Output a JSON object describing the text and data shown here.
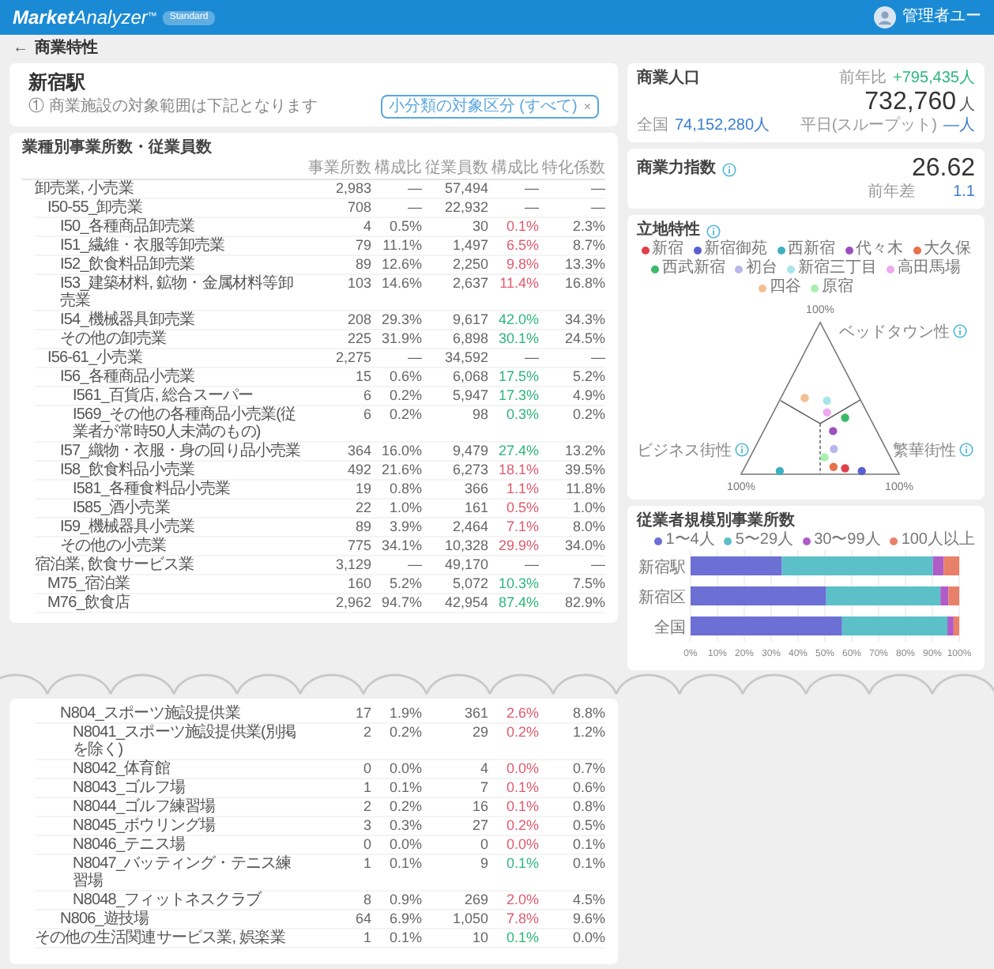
{
  "header": {
    "logo_bold": "Market",
    "logo_light": "Analyzer",
    "logo_mark": "™",
    "badge": "Standard",
    "user": "管理者ユー"
  },
  "breadcrumb": {
    "back": "←",
    "title": "商業特性"
  },
  "station": {
    "name": "新宿駅",
    "note": "① 商業施設の対象範囲は下記となります",
    "select": "小分類の対象区分 (すべて)",
    "select_clear": "×"
  },
  "industry_table": {
    "title": "業種別事業所数・従業員数",
    "columns": [
      "事業所数",
      "構成比",
      "従業員数",
      "構成比",
      "特化係数"
    ],
    "rows": [
      {
        "label": "卸売業, 小売業",
        "cells": [
          "2,983",
          "—",
          "57,494",
          "—",
          "—"
        ],
        "children": [
          {
            "label": "I50-55_卸売業",
            "cells": [
              "708",
              "—",
              "22,932",
              "—",
              "—"
            ],
            "children": [
              {
                "label": "I50_各種商品卸売業",
                "cells": [
                  "4",
                  "0.5%",
                  "30",
                  "0.1%",
                  "2.3%"
                ],
                "color": "#e05a6e"
              },
              {
                "label": "I51_繊維・衣服等卸売業",
                "cells": [
                  "79",
                  "11.1%",
                  "1,497",
                  "6.5%",
                  "8.7%"
                ],
                "color": "#e05a6e"
              },
              {
                "label": "I52_飲食料品卸売業",
                "cells": [
                  "89",
                  "12.6%",
                  "2,250",
                  "9.8%",
                  "13.3%"
                ],
                "color": "#e05a6e"
              },
              {
                "label": "I53_建築材料, 鉱物・金属材料等卸売業",
                "cells": [
                  "103",
                  "14.6%",
                  "2,637",
                  "11.4%",
                  "16.8%"
                ],
                "color": "#e05a6e"
              },
              {
                "label": "I54_機械器具卸売業",
                "cells": [
                  "208",
                  "29.3%",
                  "9,617",
                  "42.0%",
                  "34.3%"
                ],
                "color": "#2db67c"
              },
              {
                "label": "その他の卸売業",
                "cells": [
                  "225",
                  "31.9%",
                  "6,898",
                  "30.1%",
                  "24.5%"
                ],
                "color": "#2db67c"
              }
            ]
          },
          {
            "label": "I56-61_小売業",
            "cells": [
              "2,275",
              "—",
              "34,592",
              "—",
              "—"
            ],
            "children": [
              {
                "label": "I56_各種商品小売業",
                "cells": [
                  "15",
                  "0.6%",
                  "6,068",
                  "17.5%",
                  "5.2%"
                ],
                "color": "#2db67c",
                "children": [
                  {
                    "label": "I561_百貨店, 総合スーパー",
                    "cells": [
                      "6",
                      "0.2%",
                      "5,947",
                      "17.3%",
                      "4.9%"
                    ],
                    "color": "#2db67c"
                  },
                  {
                    "label": "I569_その他の各種商品小売業(従業者が常時50人未満のもの)",
                    "cells": [
                      "6",
                      "0.2%",
                      "98",
                      "0.3%",
                      "0.2%"
                    ],
                    "color": "#2db67c"
                  }
                ]
              },
              {
                "label": "I57_織物・衣服・身の回り品小売業",
                "cells": [
                  "364",
                  "16.0%",
                  "9,479",
                  "27.4%",
                  "13.2%"
                ],
                "color": "#2db67c"
              },
              {
                "label": "I58_飲食料品小売業",
                "cells": [
                  "492",
                  "21.6%",
                  "6,273",
                  "18.1%",
                  "39.5%"
                ],
                "color": "#e05a6e",
                "children": [
                  {
                    "label": "I581_各種食料品小売業",
                    "cells": [
                      "19",
                      "0.8%",
                      "366",
                      "1.1%",
                      "11.8%"
                    ],
                    "color": "#e05a6e"
                  },
                  {
                    "label": "I585_酒小売業",
                    "cells": [
                      "22",
                      "1.0%",
                      "161",
                      "0.5%",
                      "1.0%"
                    ],
                    "color": "#e05a6e"
                  }
                ]
              },
              {
                "label": "I59_機械器具小売業",
                "cells": [
                  "89",
                  "3.9%",
                  "2,464",
                  "7.1%",
                  "8.0%"
                ],
                "color": "#e05a6e"
              },
              {
                "label": "その他の小売業",
                "cells": [
                  "775",
                  "34.1%",
                  "10,328",
                  "29.9%",
                  "34.0%"
                ],
                "color": "#e05a6e"
              }
            ]
          }
        ]
      },
      {
        "label": "宿泊業, 飲食サービス業",
        "cells": [
          "3,129",
          "—",
          "49,170",
          "—",
          "—"
        ],
        "children": [
          {
            "label": "M75_宿泊業",
            "cells": [
              "160",
              "5.2%",
              "5,072",
              "10.3%",
              "7.5%"
            ],
            "color": "#2db67c"
          },
          {
            "label": "M76_飲食店",
            "cells": [
              "2,962",
              "94.7%",
              "42,954",
              "87.4%",
              "82.9%"
            ],
            "color": "#2db67c"
          }
        ]
      }
    ],
    "rows_after_break": [
      {
        "kind": "continued",
        "label": "N804_スポーツ施設提供業",
        "cells": [
          "17",
          "1.9%",
          "361",
          "2.6%",
          "8.8%"
        ],
        "color": "#e05a6e",
        "children": [
          {
            "label": "N8041_スポーツ施設提供業(別掲を除く)",
            "cells": [
              "2",
              "0.2%",
              "29",
              "0.2%",
              "1.2%"
            ],
            "color": "#e05a6e"
          },
          {
            "label": "N8042_体育館",
            "cells": [
              "0",
              "0.0%",
              "4",
              "0.0%",
              "0.7%"
            ],
            "color": "#e05a6e"
          },
          {
            "label": "N8043_ゴルフ場",
            "cells": [
              "1",
              "0.1%",
              "7",
              "0.1%",
              "0.6%"
            ],
            "color": "#e05a6e"
          },
          {
            "label": "N8044_ゴルフ練習場",
            "cells": [
              "2",
              "0.2%",
              "16",
              "0.1%",
              "0.8%"
            ],
            "color": "#e05a6e"
          },
          {
            "label": "N8045_ボウリング場",
            "cells": [
              "3",
              "0.3%",
              "27",
              "0.2%",
              "0.5%"
            ],
            "color": "#e05a6e"
          },
          {
            "label": "N8046_テニス場",
            "cells": [
              "0",
              "0.0%",
              "0",
              "0.0%",
              "0.1%"
            ],
            "color": "#e05a6e"
          },
          {
            "label": "N8047_バッティング・テニス練習場",
            "cells": [
              "1",
              "0.1%",
              "9",
              "0.1%",
              "0.1%"
            ],
            "color": "#2db67c"
          },
          {
            "label": "N8048_フィットネスクラブ",
            "cells": [
              "8",
              "0.9%",
              "269",
              "2.0%",
              "4.5%"
            ],
            "color": "#e05a6e"
          }
        ]
      },
      {
        "kind": "continued",
        "label": "N806_遊技場",
        "cells": [
          "64",
          "6.9%",
          "1,050",
          "7.8%",
          "9.6%"
        ],
        "color": "#e05a6e"
      },
      {
        "kind": "row",
        "label": "その他の生活関連サービス業, 娯楽業",
        "cells": [
          "1",
          "0.1%",
          "10",
          "0.1%",
          "0.0%"
        ],
        "color": "#2db67c"
      }
    ]
  },
  "population": {
    "title": "商業人口",
    "change_label": "前年比",
    "change": "+795,435人",
    "value": "732,760",
    "unit": "人",
    "details": [
      {
        "label": "全国",
        "value": "74,152,280人"
      },
      {
        "label": "平日(スループット)",
        "value": "—人"
      }
    ]
  },
  "index": {
    "title": "商業力指数",
    "value": "26.62",
    "label": "前年差",
    "change": "1.1"
  },
  "location": {
    "title": "立地特性",
    "legend": [
      {
        "name": "新宿",
        "color": "#e0404a"
      },
      {
        "name": "新宿御苑",
        "color": "#5a5fd0"
      },
      {
        "name": "西新宿",
        "color": "#3fb0c0"
      },
      {
        "name": "代々木",
        "color": "#9c4fc0"
      },
      {
        "name": "大久保",
        "color": "#e8704a"
      },
      {
        "name": "西武新宿",
        "color": "#3cb86a"
      },
      {
        "name": "初台",
        "color": "#b8b8ec"
      },
      {
        "name": "新宿三丁目",
        "color": "#a8e4ec"
      },
      {
        "name": "高田馬場",
        "color": "#f0a8f0"
      },
      {
        "name": "四谷",
        "color": "#f4c090"
      },
      {
        "name": "原宿",
        "color": "#a8f0b0"
      }
    ],
    "top_label": "ベッドタウン性",
    "top_max": "100%",
    "left_label": "ビジネス街性",
    "left_max": "100%",
    "right_label": "繁華街性",
    "right_max": "100%"
  },
  "scale_chart": {
    "title": "従業者規模別事業所数",
    "chart_data": {
      "type": "bar",
      "orientation": "horizontal",
      "stacked": true,
      "categories": [
        "新宿駅",
        "新宿区",
        "全国"
      ],
      "series": [
        {
          "name": "1〜4人",
          "color": "#6c6fd4",
          "values": [
            34,
            50.5,
            56.4
          ]
        },
        {
          "name": "5〜29人",
          "color": "#5bc0c8",
          "values": [
            56.2,
            42.5,
            39.2
          ]
        },
        {
          "name": "30〜99人",
          "color": "#b05cc8",
          "values": [
            4,
            3,
            2.3
          ]
        },
        {
          "name": "100人以上",
          "color": "#e9806a",
          "values": [
            5.8,
            4,
            2.1
          ]
        }
      ],
      "xlim": [
        0,
        100
      ],
      "grid": true,
      "xticks": [
        {
          "value": 0,
          "label": "0%"
        },
        {
          "value": 10,
          "label": "10%"
        },
        {
          "value": 20,
          "label": "20%"
        },
        {
          "value": 30,
          "label": "30%"
        },
        {
          "value": 40,
          "label": "40%"
        },
        {
          "value": 50,
          "label": "50%"
        },
        {
          "value": 60,
          "label": "60%"
        },
        {
          "value": 70,
          "label": "70%"
        },
        {
          "value": 80,
          "label": "80%"
        },
        {
          "value": 90,
          "label": "90%"
        },
        {
          "value": 100,
          "label": "100%"
        }
      ]
    }
  }
}
